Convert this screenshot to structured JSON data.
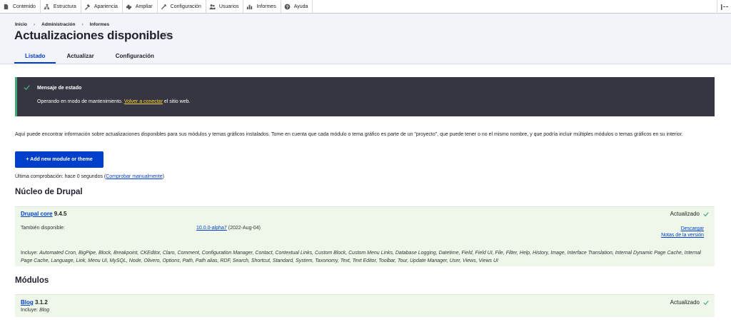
{
  "toolbar": {
    "items": [
      {
        "label": "Contenido",
        "icon": "content-icon"
      },
      {
        "label": "Estructura",
        "icon": "structure-icon"
      },
      {
        "label": "Apariencia",
        "icon": "appearance-icon"
      },
      {
        "label": "Ampliar",
        "icon": "extend-icon"
      },
      {
        "label": "Configuración",
        "icon": "wrench-icon"
      },
      {
        "label": "Usuarios",
        "icon": "users-icon"
      },
      {
        "label": "Informes",
        "icon": "reports-icon"
      },
      {
        "label": "Ayuda",
        "icon": "help-icon"
      }
    ]
  },
  "breadcrumb": [
    "Inicio",
    "Administración",
    "Informes"
  ],
  "page_title": "Actualizaciones disponibles",
  "tabs": [
    "Listado",
    "Actualizar",
    "Configuración"
  ],
  "status": {
    "title": "Mensaje de estado",
    "msg_prefix": "Operando en modo de mantenimiento.",
    "msg_link": "Volver a conectar",
    "msg_suffix": "el sitio web.",
    "accent": "#42a877"
  },
  "intro": "Aquí puede encontrar información sobre actualizaciones disponibles para sus módulos y temas gráficos instalados. Tome en cuenta que cada módulo o tema gráfico es parte de un \"proyecto\", que puede tener o no el mismo nombre, y que podría incluir múltiples módulos o temas gráficos en su interior.",
  "add_button": "+ Add new module or theme",
  "last_check": {
    "prefix": "Última comprobación: hace 0 segundos (",
    "link": "Comprobar manualmente",
    "suffix": ")"
  },
  "core": {
    "heading": "Núcleo de Drupal",
    "name": "Drupal core",
    "version": "9.4.5",
    "status": "Actualizado",
    "also_label": "También disponible:",
    "also_version": "10.0.0-alpha7",
    "also_date": "(2022-Aug-04)",
    "download": "Descargar",
    "release_notes": "Notas de la versión",
    "includes_label": "Incluye:",
    "includes": "Automated Cron, BigPipe, Block, Breakpoint, CKEditor, Claro, Comment, Configuration Manager, Contact, Contextual Links, Custom Block, Custom Menu Links, Database Logging, Datetime, Field, Field UI, File, Filter, Help, History, Image, Interface Translation, Internal Dynamic Page Cache, Internal Page Cache, Language, Link, Menu UI, MySQL, Node, Olivero, Options, Path, Path alias, RDF, Search, Shortcut, Standard, System, Taxonomy, Text, Text Editor, Toolbar, Tour, Update Manager, User, Views, Views UI"
  },
  "modules": {
    "heading": "Módulos",
    "name": "Blog",
    "version": "3.1.2",
    "status": "Actualizado",
    "includes_label": "Incluye:",
    "includes": "Blog"
  }
}
